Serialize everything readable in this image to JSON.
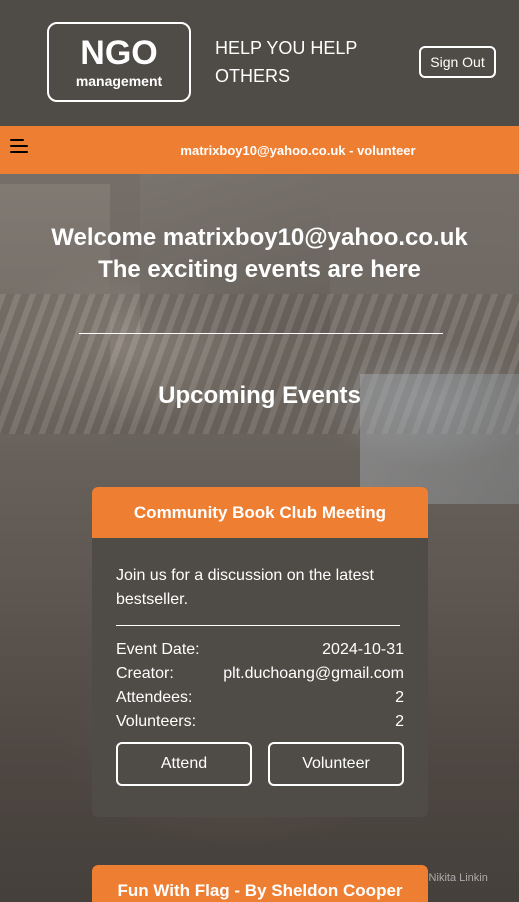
{
  "header": {
    "logo_big": "NGO",
    "logo_small": "management",
    "tagline_line1": "HELP YOU HELP",
    "tagline_line2": "OTHERS",
    "signout_label": "Sign Out"
  },
  "userbar": {
    "user_label": "matrixboy10@yahoo.co.uk - volunteer"
  },
  "hero": {
    "welcome_line1": "Welcome matrixboy10@yahoo.co.uk",
    "welcome_line2": "The exciting events are here",
    "section_title": "Upcoming Events",
    "photo_credit": "y Nikita Linkin"
  },
  "events": [
    {
      "title": "Community Book Club Meeting",
      "description": "Join us for a discussion on the latest bestseller.",
      "date_label": "Event Date:",
      "date": "2024-10-31",
      "creator_label": "Creator:",
      "creator": "plt.duchoang@gmail.com",
      "attendees_label": "Attendees:",
      "attendees": "2",
      "volunteers_label": "Volunteers:",
      "volunteers": "2",
      "attend_label": "Attend",
      "volunteer_label": "Volunteer"
    },
    {
      "title": "Fun With Flag - By Sheldon Cooper"
    }
  ],
  "colors": {
    "accent": "#ee7f32",
    "dark": "#4f4b46"
  }
}
